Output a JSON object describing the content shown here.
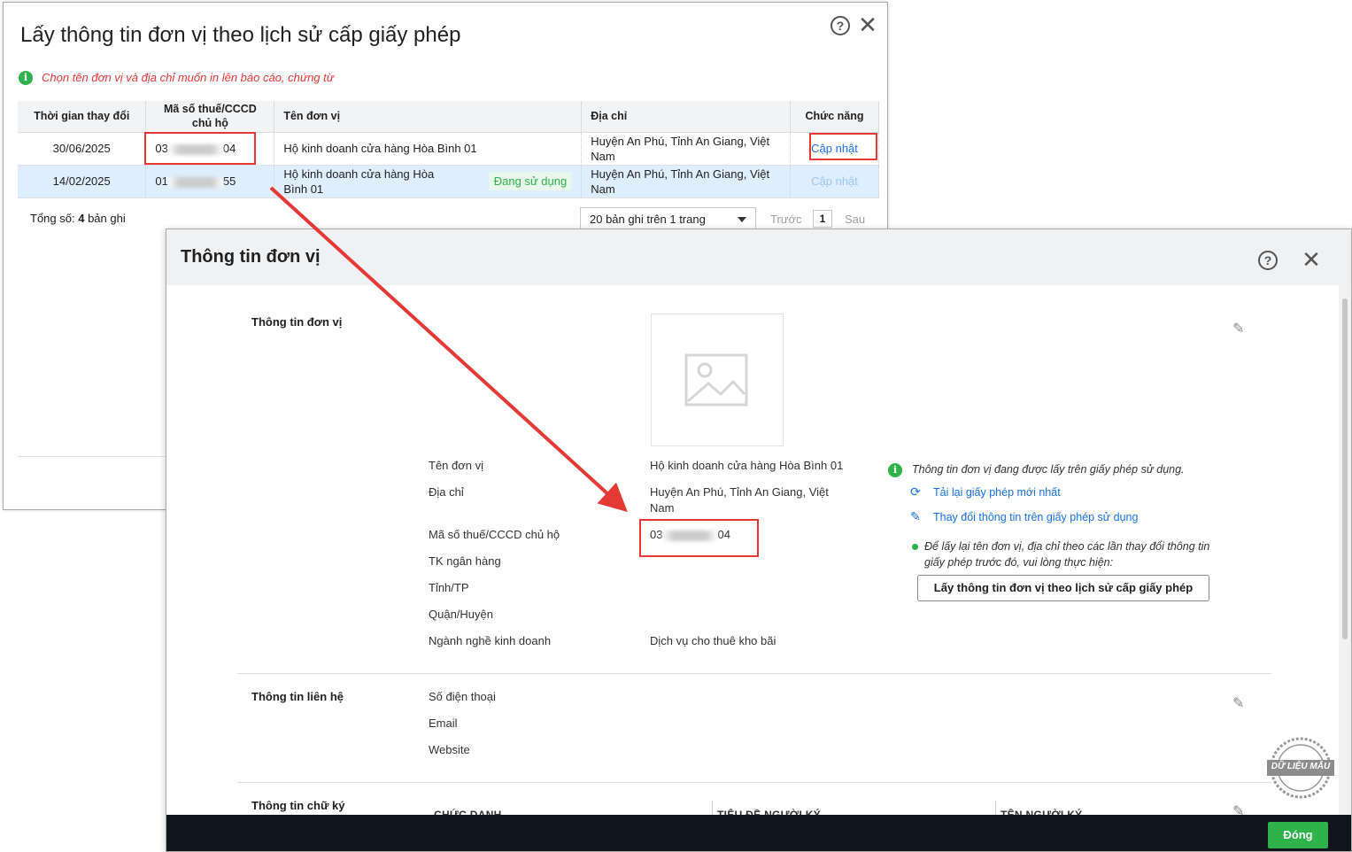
{
  "history_dialog": {
    "title": "Lấy thông tin đơn vị theo lịch sử cấp giấy phép",
    "hint": "Chọn tên đơn vị và địa chỉ muốn in lên báo cáo, chứng từ",
    "columns": [
      "Thời gian thay đổi",
      "Mã số thuế/CCCD chủ hộ",
      "Tên đơn vị",
      "Địa chỉ",
      "Chức năng"
    ],
    "rows": [
      {
        "date": "30/06/2025",
        "tax_prefix": "03",
        "tax_suffix": "04",
        "name": "Hộ kinh doanh cửa hàng Hòa Bình 01",
        "status": "",
        "address": "Huyện An Phú, Tỉnh An Giang, Việt Nam",
        "action": "Cập nhật"
      },
      {
        "date": "14/02/2025",
        "tax_prefix": "01",
        "tax_suffix": "55",
        "name": "Hộ kinh doanh cửa hàng Hòa Bình 01",
        "status": "Đang sử dụng",
        "address": "Huyện An Phú, Tỉnh An Giang, Việt Nam",
        "action": "Cập nhật"
      }
    ],
    "total_prefix": "Tổng số:",
    "total_count": "4",
    "total_suffix": "bản ghi",
    "page_size": "20 bản ghi trên 1 trang",
    "prev": "Trước",
    "page": "1",
    "next": "Sau"
  },
  "unit_dialog": {
    "title": "Thông tin đơn vị",
    "section_unit": "Thông tin đơn vị",
    "labels": {
      "name": "Tên đơn vị",
      "address": "Địa chỉ",
      "tax": "Mã số thuế/CCCD chủ hộ",
      "bank": "TK ngân hàng",
      "province": "Tỉnh/TP",
      "district": "Quận/Huyện",
      "business": "Ngành nghề kinh doanh"
    },
    "values": {
      "name": "Hộ kinh doanh cửa hàng Hòa Bình 01",
      "address": "Huyện An Phú, Tỉnh An Giang, Việt Nam",
      "tax_prefix": "03",
      "tax_suffix": "04",
      "business": "Dịch vụ cho thuê kho bãi"
    },
    "info_note": "Thông tin đơn vị đang được lấy trên giấy phép sử dụng.",
    "reload_action": "Tải lại giấy phép mới nhất",
    "change_action": "Thay đổi thông tin trên giấy phép sử dụng",
    "history_note": "Để lấy lại tên đơn vị, địa chỉ theo các lần thay đổi thông tin giấy phép trước đó, vui lòng thực hiện:",
    "history_button": "Lấy thông tin đơn vị theo lịch sử cấp giấy phép",
    "section_contact": "Thông tin liên hệ",
    "contact_labels": {
      "phone": "Số điện thoại",
      "email": "Email",
      "website": "Website"
    },
    "section_signature": "Thông tin chữ ký",
    "signature_columns": [
      "CHỨC DANH",
      "TIÊU ĐỀ NGƯỜI KÝ",
      "TÊN NGƯỜI KÝ"
    ],
    "close_button": "Đóng",
    "watermark": "DỮ LIỆU MẪU"
  },
  "colors": {
    "accent_red": "#e53935",
    "green": "#2db34a",
    "link_blue": "#1a73e8"
  }
}
